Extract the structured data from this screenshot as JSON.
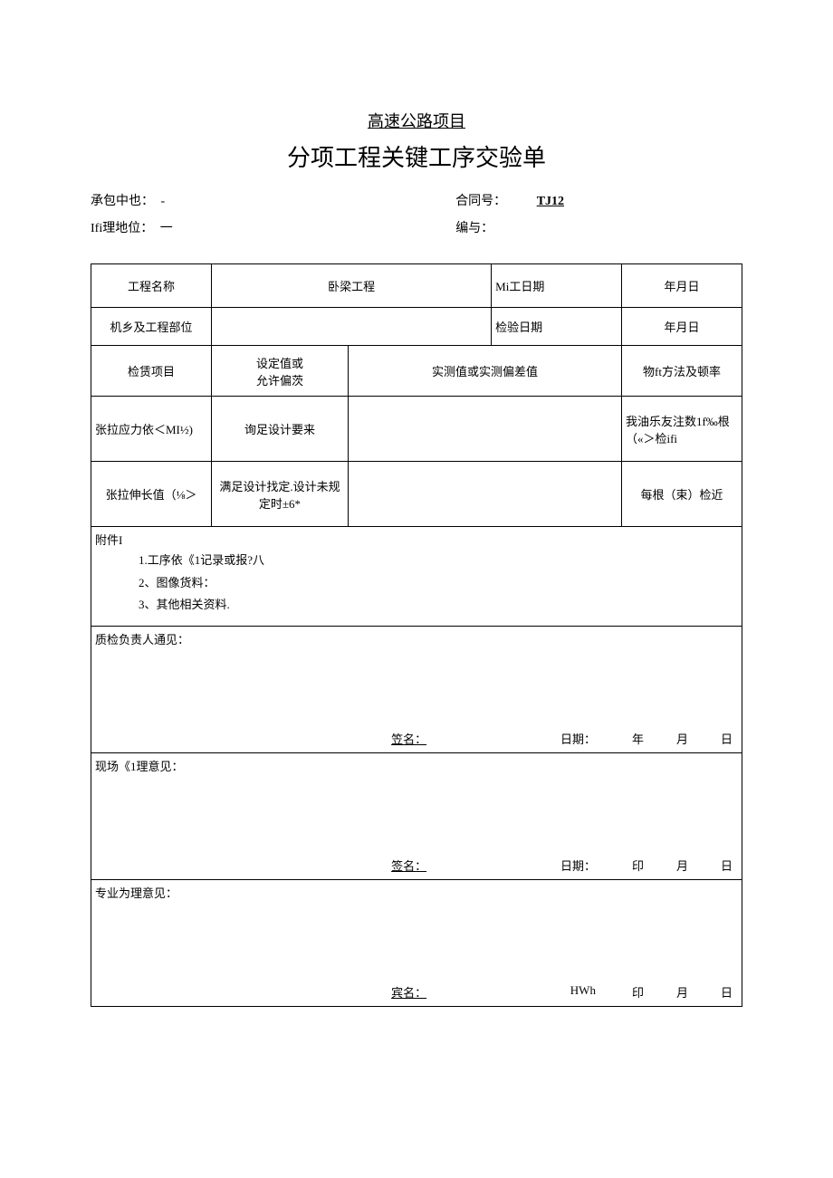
{
  "header": {
    "line1": "高速公路项目",
    "line2": "分项工程关键工序交验单"
  },
  "meta": {
    "contractor_label": "承包中也：",
    "contractor_value": "-",
    "contract_no_label": "合同号：",
    "contract_no_value": "TJ12",
    "supervisor_label": "Ifi理地位：",
    "supervisor_value": "一",
    "serial_label": "编与：",
    "serial_value": ""
  },
  "table": {
    "r1c1": "工程名称",
    "r1c2": "卧梁工程",
    "r1c3": "Mi工日期",
    "r1c4": "年月日",
    "r2c1": "机乡及工程部位",
    "r2c2": "",
    "r2c3": "检验日期",
    "r2c4": "年月日",
    "r3c1": "检赁项目",
    "r3c2": "设定值或\n允许偏茨",
    "r3c3": "实测值或实测偏差值",
    "r3c4": "物ft方法及顿率",
    "r4c1": "张拉应力依＜MI½)",
    "r4c2": "询足设计要来",
    "r4c3": "",
    "r4c4": "我油乐友注数1f‰根（«＞检ifi",
    "r5c1": "张拉伸长值（⅛＞",
    "r5c2": "满足设计找定.设计未规定时±6*",
    "r5c3": "",
    "r5c4": "每根（束）检近"
  },
  "attach": {
    "title": "附件I",
    "item1": "1.工序依《1记录或报?八",
    "item2": "2、图像货料：",
    "item3": "3、其他相关资料."
  },
  "opinion1": {
    "title": "质检负责人通见：",
    "sign": "笠名：",
    "date_label": "日期：",
    "y": "年",
    "m": "月",
    "d": "日"
  },
  "opinion2": {
    "title": "现场《1理意见：",
    "sign": "签名：",
    "date_label": "日期：",
    "y": "印",
    "m": "月",
    "d": "日"
  },
  "opinion3": {
    "title": "专业为理意见：",
    "sign": "宾名：",
    "date_label": "HWh",
    "y": "印",
    "m": "月",
    "d": "日"
  }
}
